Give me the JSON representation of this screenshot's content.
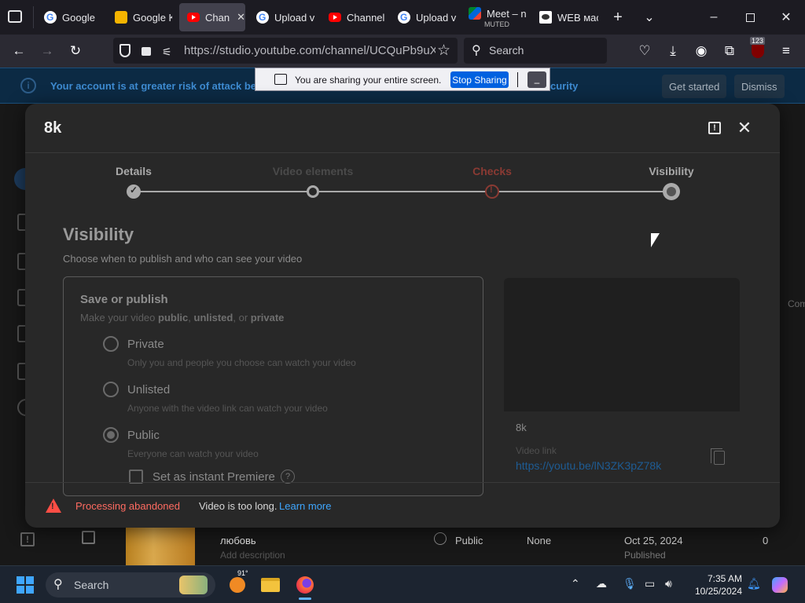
{
  "browser": {
    "tabs": [
      {
        "label": "Google",
        "icon": "google-icon",
        "active": false
      },
      {
        "label": "Google K",
        "icon": "google-keep-icon",
        "active": false
      },
      {
        "label": "Chann",
        "icon": "youtube-icon",
        "active": true
      },
      {
        "label": "Upload v",
        "icon": "google-icon",
        "active": false
      },
      {
        "label": "Channel",
        "icon": "youtube-icon",
        "active": false
      },
      {
        "label": "Upload v",
        "icon": "google-icon",
        "active": false
      },
      {
        "label": "Meet – n",
        "sublabel": "MUTED",
        "icon": "google-meet-icon",
        "active": false
      },
      {
        "label": "WEB мас",
        "icon": "web-icon",
        "active": false
      }
    ],
    "url": "https://studio.youtube.com/channel/UCQuPb9uXb",
    "url_host": "studio.youtube.com",
    "search_placeholder": "Search",
    "extension_badge": "123"
  },
  "security_banner": {
    "message": "Your account is at greater risk of attack beca",
    "message_tail": "curity",
    "get_started": "Get started",
    "dismiss": "Dismiss"
  },
  "share_toolbar": {
    "text": "You are sharing your entire screen.",
    "stop_label": "Stop Sharing",
    "minimize_label": "–"
  },
  "modal": {
    "title": "8k",
    "steps": [
      {
        "label": "Details",
        "state": "done",
        "color": "#aaaaaa"
      },
      {
        "label": "Video elements",
        "state": "visited",
        "color": "#4a4a4a"
      },
      {
        "label": "Checks",
        "state": "warning",
        "color": "#8a3a33"
      },
      {
        "label": "Visibility",
        "state": "current",
        "color": "#aaaaaa"
      }
    ],
    "heading": "Visibility",
    "subheading": "Choose when to publish and who can see your video",
    "card": {
      "title": "Save or publish",
      "subtitle_prefix": "Make your video ",
      "subtitle_public": "public",
      "subtitle_sep1": ", ",
      "subtitle_unlisted": "unlisted",
      "subtitle_sep2": ", or ",
      "subtitle_private": "private",
      "options": [
        {
          "label": "Private",
          "description": "Only you and people you choose can watch your video",
          "selected": false
        },
        {
          "label": "Unlisted",
          "description": "Anyone with the video link can watch your video",
          "selected": false
        },
        {
          "label": "Public",
          "description": "Everyone can watch your video",
          "selected": true
        }
      ],
      "premiere_label": "Set as instant Premiere",
      "help_glyph": "?"
    },
    "preview": {
      "title": "8k",
      "link_label": "Video link",
      "link": "https://youtu.be/lN3ZK3pZ78k"
    },
    "footer": {
      "status": "Processing abandoned",
      "message": "Video is too long.",
      "link": "Learn more"
    }
  },
  "background_row": {
    "title": "любовь",
    "description": "Add description",
    "visibility": "Public",
    "restrictions": "None",
    "date": "Oct 25, 2024",
    "date_status": "Published",
    "views": "0",
    "side_label": "Com"
  },
  "taskbar": {
    "search_placeholder": "Search",
    "weather_temp": "91°",
    "time": "7:35 AM",
    "date": "10/25/2024"
  }
}
